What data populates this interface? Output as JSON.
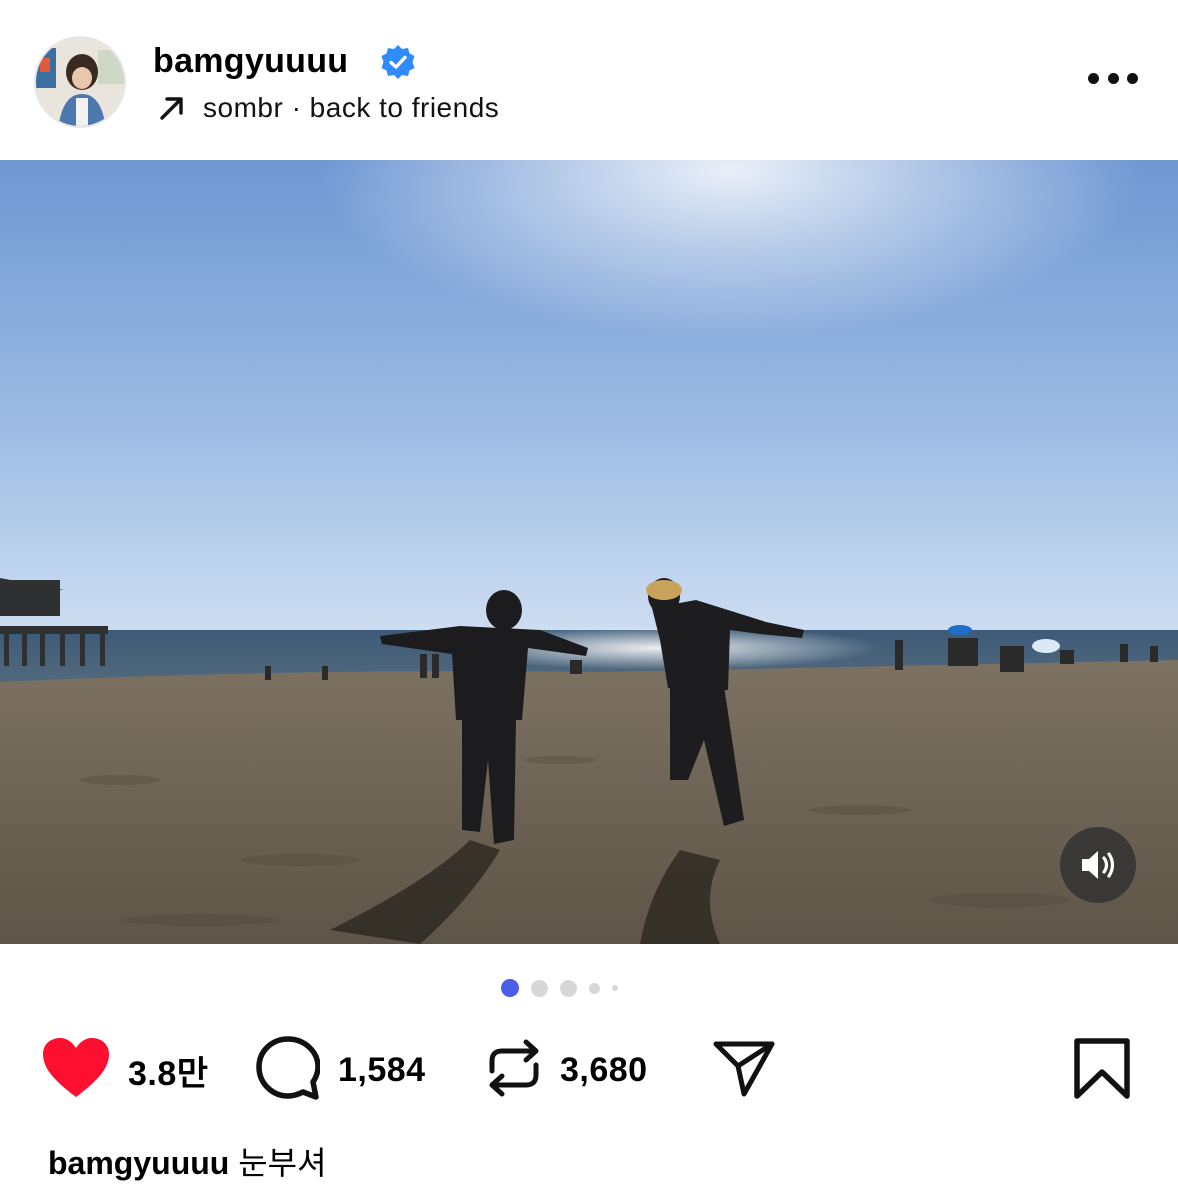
{
  "header": {
    "username": "bamgyuuuu",
    "verified": true,
    "music_icon": "arrow-up-right-icon",
    "music_text": "sombr · back to friends",
    "more_icon": "more-options-icon"
  },
  "media": {
    "description_icon": "beach-photo",
    "sound_icon": "speaker-icon",
    "carousel_total": 5,
    "carousel_active": 1
  },
  "actions": {
    "likes": "3.8만",
    "comments": "1,584",
    "reposts": "3,680",
    "liked": true,
    "like_color": "#ff0f2f"
  },
  "caption": {
    "username": "bamgyuuuu",
    "text": "눈부셔"
  },
  "colors": {
    "accent_dot": "#4a5ee8",
    "verified_blue": "#2f8cff"
  }
}
